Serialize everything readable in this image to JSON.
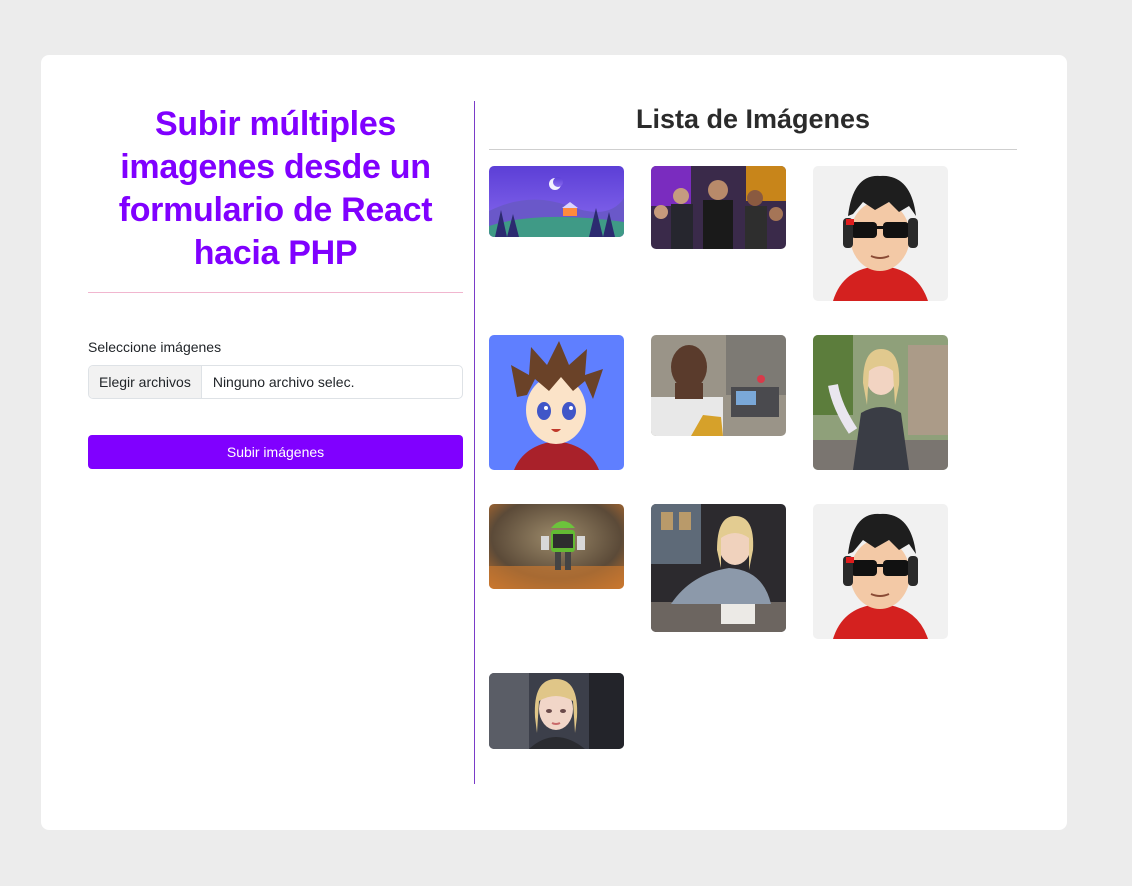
{
  "upload_form": {
    "title": "Subir múltiples imagenes desde un formulario de React hacia PHP",
    "field_label": "Seleccione imágenes",
    "file_button_label": "Elegir archivos",
    "file_status": "Ninguno archivo selec.",
    "submit_label": "Subir imágenes"
  },
  "image_list": {
    "title": "Lista de Imágenes",
    "images": [
      {
        "name": "night-landscape-image"
      },
      {
        "name": "movie-cast-image"
      },
      {
        "name": "cartoon-avatar-headphones-image"
      },
      {
        "name": "anime-boy-image"
      },
      {
        "name": "selfie-office-image"
      },
      {
        "name": "blonde-woman-street-image"
      },
      {
        "name": "android-robot-image"
      },
      {
        "name": "blonde-woman-desk-image"
      },
      {
        "name": "cartoon-avatar-headphones-image"
      },
      {
        "name": "blonde-woman-portrait-image"
      }
    ]
  },
  "colors": {
    "accent": "#8000ff",
    "page_background": "#ececec",
    "card_background": "#ffffff"
  }
}
